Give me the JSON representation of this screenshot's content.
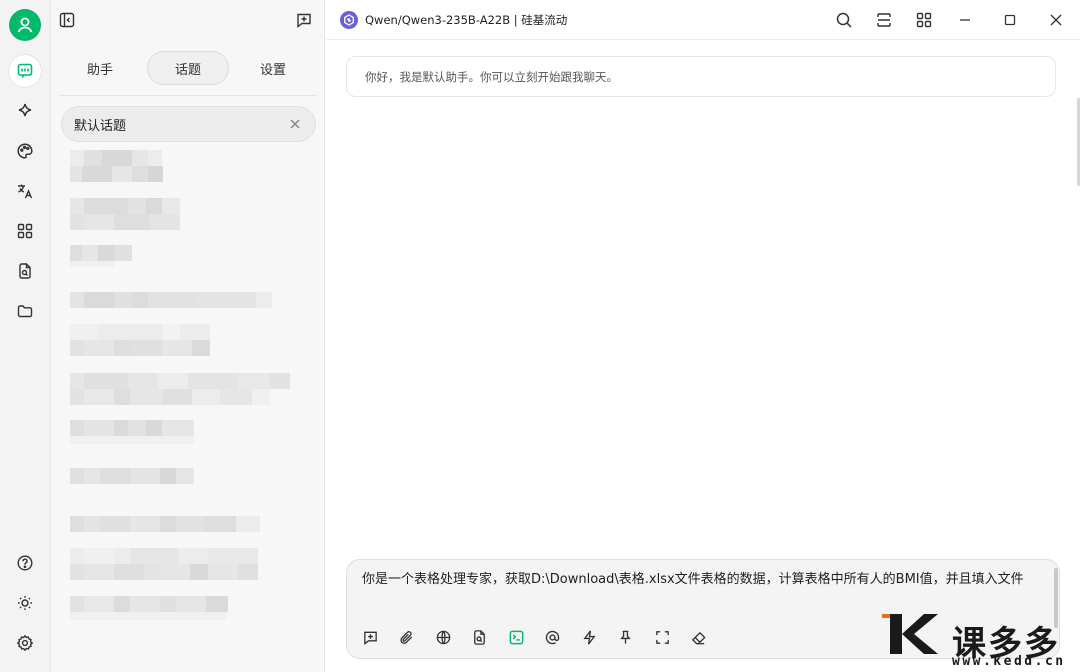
{
  "header": {
    "model_label": "Qwen/Qwen3-235B-A22B | 硅基流动"
  },
  "panel": {
    "tabs": [
      {
        "label": "助手"
      },
      {
        "label": "话题"
      },
      {
        "label": "设置"
      }
    ],
    "active_tab": "话题",
    "selected_topic": "默认话题"
  },
  "chat": {
    "greeting": "你好，我是默认助手。你可以立刻开始跟我聊天。"
  },
  "composer": {
    "value": "你是一个表格处理专家，获取D:\\Download\\表格.xlsx文件表格的数据，计算表格中所有人的BMI值，并且填入文件"
  },
  "watermark": {
    "brand": "课多多",
    "url": "www.kedd.cn"
  },
  "colors": {
    "accent_green": "#00b96b",
    "model_logo": "#6b5fd8",
    "watermark_orange": "#f26b1d"
  },
  "icons": {
    "rail": [
      "user-avatar-icon",
      "chat-icon",
      "sparkle-icon",
      "palette-icon",
      "translate-icon",
      "apps-grid-icon",
      "file-search-icon",
      "folder-icon",
      "help-icon",
      "brightness-icon",
      "settings-icon"
    ],
    "composer_tools": [
      "new-topic-icon",
      "attachment-icon",
      "web-search-icon",
      "knowledge-file-icon",
      "terminal-mcp-icon",
      "mention-icon",
      "quick-phrase-icon",
      "pin-icon",
      "fullscreen-icon",
      "clear-icon"
    ]
  }
}
